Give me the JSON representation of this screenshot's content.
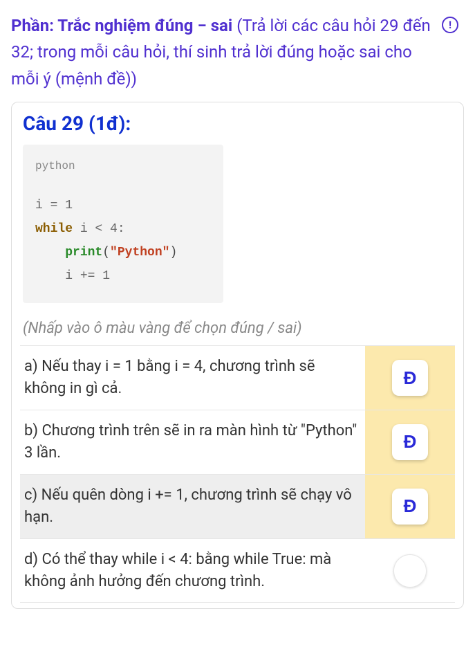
{
  "section": {
    "title_bold": "Phần: Trắc nghiệm đúng − sai",
    "title_rest": " (Trả lời các câu hỏi 29 đến 32; trong mỗi câu hỏi, thí sinh trả lời đúng hoặc sai cho mỗi ý (mệnh đề))",
    "info_glyph": "!"
  },
  "question": {
    "title": "Câu 29 (1đ):",
    "code": {
      "lang": "python",
      "line1_i": "i",
      "line1_eq": " = ",
      "line1_val": "1",
      "line2_kw": "while",
      "line2_rest": " i < 4:",
      "line3_indent": "    ",
      "line3_fn": "print",
      "line3_open": "(",
      "line3_str": "\"Python\"",
      "line3_close": ")",
      "line4_indent": "    ",
      "line4_text": "i += 1"
    },
    "hint": "(Nhấp vào ô màu vàng để chọn đúng / sai)",
    "options": [
      {
        "text": "a) Nếu thay i = 1 bằng i = 4, chương trình sẽ không in gì cả.",
        "selected": "Đ",
        "shaded": false,
        "has_button": true
      },
      {
        "text": "b) Chương trình trên sẽ in ra màn hình từ \"Python\" 3 lần.",
        "selected": "Đ",
        "shaded": false,
        "has_button": true
      },
      {
        "text": "c) Nếu quên dòng i += 1, chương trình sẽ chạy vô hạn.",
        "selected": "Đ",
        "shaded": true,
        "has_button": true
      },
      {
        "text": "d) Có thể thay while i < 4: bằng while True: mà không ảnh hưởng đến chương trình.",
        "selected": "",
        "shaded": false,
        "has_button": false
      }
    ]
  }
}
